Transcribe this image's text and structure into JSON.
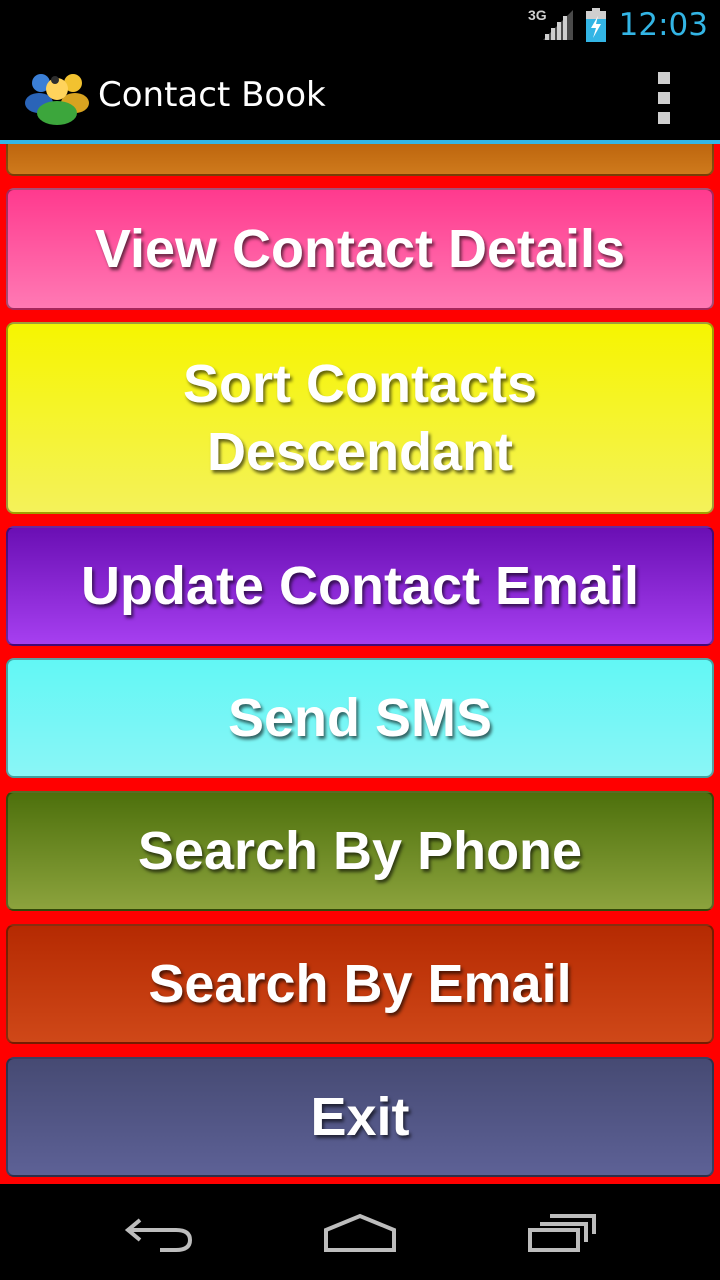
{
  "status_bar": {
    "network_type": "3G",
    "time": "12:03",
    "signal_icon": "signal-icon",
    "battery_icon": "battery-charging-icon"
  },
  "action_bar": {
    "title": "Contact Book",
    "app_icon": "contacts-group-icon",
    "overflow_icon": "overflow-menu-icon"
  },
  "menu": {
    "partial_top_label": "",
    "buttons": [
      {
        "label": "View Contact Details",
        "color_top": "#ff3a8e"
      },
      {
        "label": "Sort Contacts Descendant",
        "color_top": "#f6f500"
      },
      {
        "label": "Update Contact Email",
        "color_top": "#6a0fb4"
      },
      {
        "label": "Send SMS",
        "color_top": "#62f7f5"
      },
      {
        "label": "Search By Phone",
        "color_top": "#4d700c"
      },
      {
        "label": "Search By Email",
        "color_top": "#b52a02"
      },
      {
        "label": "Exit",
        "color_top": "#464a73"
      }
    ]
  },
  "colors": {
    "content_background": "#ff0000",
    "accent": "#33b5e5"
  },
  "nav_bar": {
    "back_icon": "back-icon",
    "home_icon": "home-icon",
    "recents_icon": "recent-apps-icon"
  }
}
